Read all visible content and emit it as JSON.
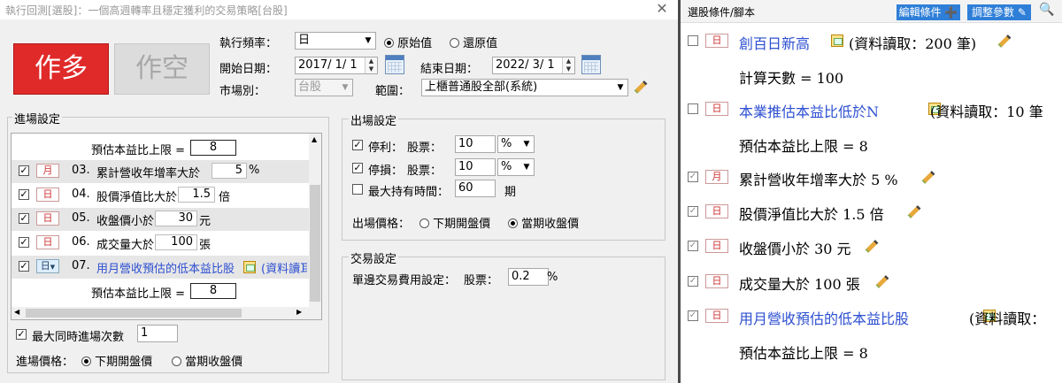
{
  "window": {
    "title": "執行回測[選股]：一個高週轉率且穩定獲利的交易策略[台股]",
    "close": "✕"
  },
  "direction": {
    "long_label": "作多",
    "short_label": "作空"
  },
  "exec": {
    "freq_label": "執行頻率：",
    "freq_value": "日",
    "radio_original": "原始值",
    "radio_restore": "還原值",
    "start_label": "開始日期：",
    "start_value": "2017/ 1/ 1",
    "end_label": "結束日期：",
    "end_value": "2022/ 3/ 1",
    "market_label": "市場別：",
    "market_value": "台股",
    "scope_label": "範圍：",
    "scope_value": "上櫃普通股全部(系統)"
  },
  "entry": {
    "title": "進場設定",
    "top_sub": {
      "label": "預估本益比上限 =",
      "value": "8"
    },
    "rows": [
      {
        "num": "03.",
        "badge": "月",
        "text": "累計營收年增率大於",
        "value": "5",
        "unit": "%"
      },
      {
        "num": "04.",
        "badge": "日",
        "text": "股價淨值比大於",
        "value": "1.5",
        "unit": "倍"
      },
      {
        "num": "05.",
        "badge": "日",
        "text": "收盤價小於",
        "value": "30",
        "unit": "元"
      },
      {
        "num": "06.",
        "badge": "日",
        "text": "成交量大於",
        "value": "100",
        "unit": "張"
      },
      {
        "num": "07.",
        "badge": "日",
        "text": "用月營收預估的低本益比股",
        "extra": "(資料讀耳"
      }
    ],
    "bottom_sub": {
      "label": "預估本益比上限 =",
      "value": "8"
    },
    "max_entries_label": "最大同時進場次數",
    "max_entries_value": "1",
    "price_label": "進場價格：",
    "price_next_open": "下期開盤價",
    "price_cur_close": "當期收盤價"
  },
  "exit": {
    "title": "出場設定",
    "take_profit_label": "停利：",
    "stop_loss_label": "停損：",
    "stock_label": "股票：",
    "take_profit_value": "10",
    "stop_loss_value": "10",
    "pct_unit": "%",
    "max_hold_label": "最大持有時間：",
    "max_hold_value": "60",
    "max_hold_unit": "期",
    "price_label": "出場價格：",
    "price_next_open": "下期開盤價",
    "price_cur_close": "當期收盤價"
  },
  "trade": {
    "title": "交易設定",
    "fee_label": "單邊交易費用設定：",
    "stock_label": "股票：",
    "fee_value": "0.2",
    "fee_unit": "%"
  },
  "right": {
    "header": "選股條件/腳本",
    "edit_btn": "編輯條件 ➕",
    "adjust_btn": "調整參數",
    "items": [
      {
        "badge": "日",
        "title": "創百日新高",
        "extra": "(資料讀取：200 筆)"
      },
      {
        "sub": "計算天數 = 100"
      },
      {
        "badge": "日",
        "title": "本業推估本益比低於N",
        "extra": "(資料讀取：10 筆"
      },
      {
        "sub": "預估本益比上限 = 8"
      },
      {
        "badge": "月",
        "text": "累計營收年增率大於 5 %"
      },
      {
        "badge": "日",
        "text": "股價淨值比大於 1.5 倍"
      },
      {
        "badge": "日",
        "text": "收盤價小於 30 元"
      },
      {
        "badge": "日",
        "text": "成交量大於 100 張"
      },
      {
        "badge": "日",
        "title": "用月營收預估的低本益比股",
        "extra": "(資料讀取："
      },
      {
        "sub": "預估本益比上限 = 8"
      }
    ]
  }
}
